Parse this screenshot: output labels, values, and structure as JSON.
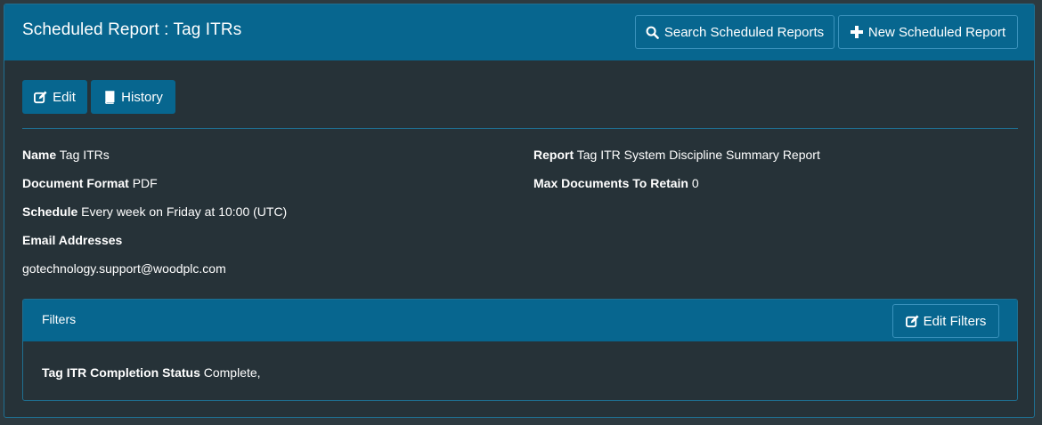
{
  "header": {
    "title": "Scheduled Report : Tag ITRs",
    "search_label": "Search Scheduled Reports",
    "new_label": "New Scheduled Report"
  },
  "actions": {
    "edit_label": "Edit",
    "history_label": "History"
  },
  "details": {
    "name_label": "Name",
    "name_value": "Tag ITRs",
    "format_label": "Document Format",
    "format_value": "PDF",
    "schedule_label": "Schedule",
    "schedule_value": "Every week on Friday at 10:00 (UTC)",
    "email_label": "Email Addresses",
    "email_value": "gotechnology.support@woodplc.com",
    "report_label": "Report",
    "report_value": "Tag ITR System Discipline Summary Report",
    "max_docs_label": "Max Documents To Retain",
    "max_docs_value": "0"
  },
  "filters": {
    "title": "Filters",
    "edit_label": "Edit Filters",
    "items": [
      {
        "label": "Tag ITR Completion Status",
        "value": "Complete,"
      }
    ]
  },
  "icons": {
    "search": "search-icon",
    "plus": "plus-icon",
    "edit": "edit-icon",
    "history": "book-icon"
  },
  "colors": {
    "header_bg": "#07668f",
    "page_bg": "#263238",
    "border": "#1f6f91"
  }
}
